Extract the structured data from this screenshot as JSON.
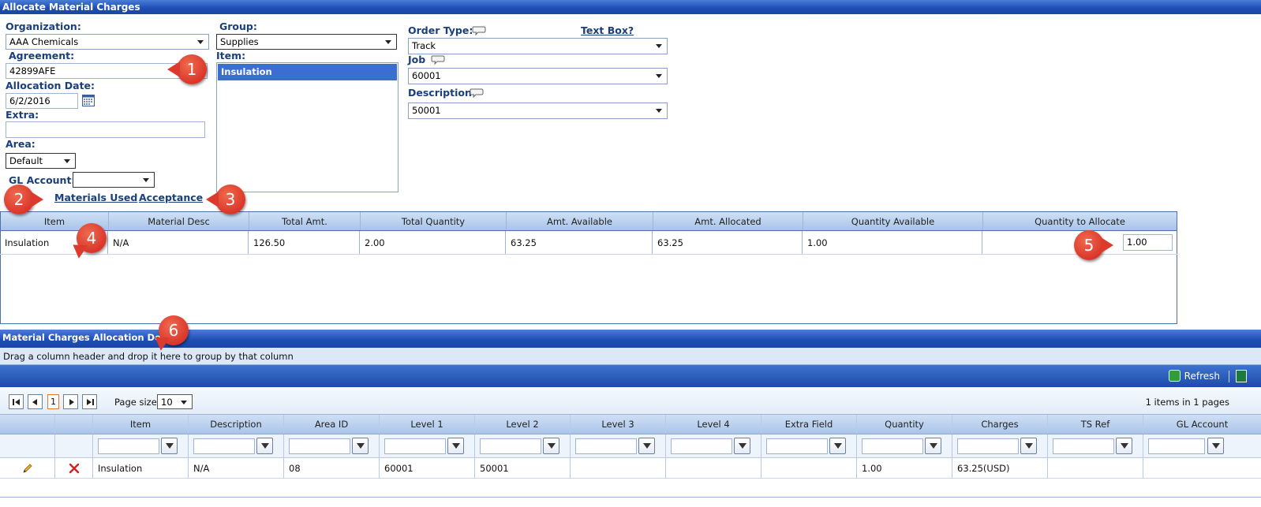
{
  "window_title": "Allocate Material Charges",
  "form": {
    "organization": {
      "label": "Organization:",
      "value": "AAA Chemicals"
    },
    "agreement": {
      "label": "Agreement:",
      "value": "42899AFE"
    },
    "allocation_date": {
      "label": "Allocation Date:",
      "value": "6/2/2016"
    },
    "extra": {
      "label": "Extra:",
      "value": ""
    },
    "area": {
      "label": "Area:",
      "value": "Default"
    },
    "gl_account": {
      "label": "GL Account:",
      "value": ""
    },
    "group": {
      "label": "Group:",
      "value": "Supplies"
    },
    "item": {
      "label": "Item:",
      "options": [
        "Insulation"
      ],
      "selected": "Insulation"
    },
    "order_type": {
      "label": "Order Type:",
      "value": "Track"
    },
    "text_box_link": "Text Box?",
    "job": {
      "label": "Job",
      "value": "60001"
    },
    "description": {
      "label": "Description",
      "value": "50001"
    }
  },
  "links": {
    "materials_used": "Materials Used",
    "acceptance": "Acceptance"
  },
  "markers": [
    "1",
    "2",
    "3",
    "4",
    "5",
    "6"
  ],
  "allocation_table": {
    "columns": [
      "Item",
      "Material Desc",
      "Total Amt.",
      "Total Quantity",
      "Amt. Available",
      "Amt. Allocated",
      "Quantity Available",
      "Quantity to Allocate"
    ],
    "rows": [
      {
        "item": "Insulation",
        "material_desc": "N/A",
        "total_amt": "126.50",
        "total_quantity": "2.00",
        "amt_available": "63.25",
        "amt_allocated": "63.25",
        "quantity_available": "1.00",
        "quantity_to_allocate": "1.00"
      }
    ]
  },
  "detail": {
    "title": "Material Charges Allocation Detail",
    "drag_hint": "Drag a column header and drop it here to group by that column",
    "refresh_label": "Refresh",
    "pager": {
      "current_page": "1",
      "page_size_label": "Page size:",
      "page_size": "10",
      "summary": "1 items in 1 pages"
    },
    "columns": [
      "Item",
      "Description",
      "Area ID",
      "Level 1",
      "Level 2",
      "Level 3",
      "Level 4",
      "Extra Field",
      "Quantity",
      "Charges",
      "TS Ref",
      "GL Account"
    ],
    "rows": [
      {
        "item": "Insulation",
        "description": "N/A",
        "area_id": "08",
        "level1": "60001",
        "level2": "50001",
        "level3": "",
        "level4": "",
        "extra_field": "",
        "quantity": "1.00",
        "charges": "63.25(USD)",
        "ts_ref": "",
        "gl_account": ""
      }
    ]
  },
  "colors": {
    "header_blue": "#1f4fb5",
    "label_blue": "#1b3f7a",
    "marker_red": "#d9362a",
    "selected_item": "#3a6fcf"
  }
}
